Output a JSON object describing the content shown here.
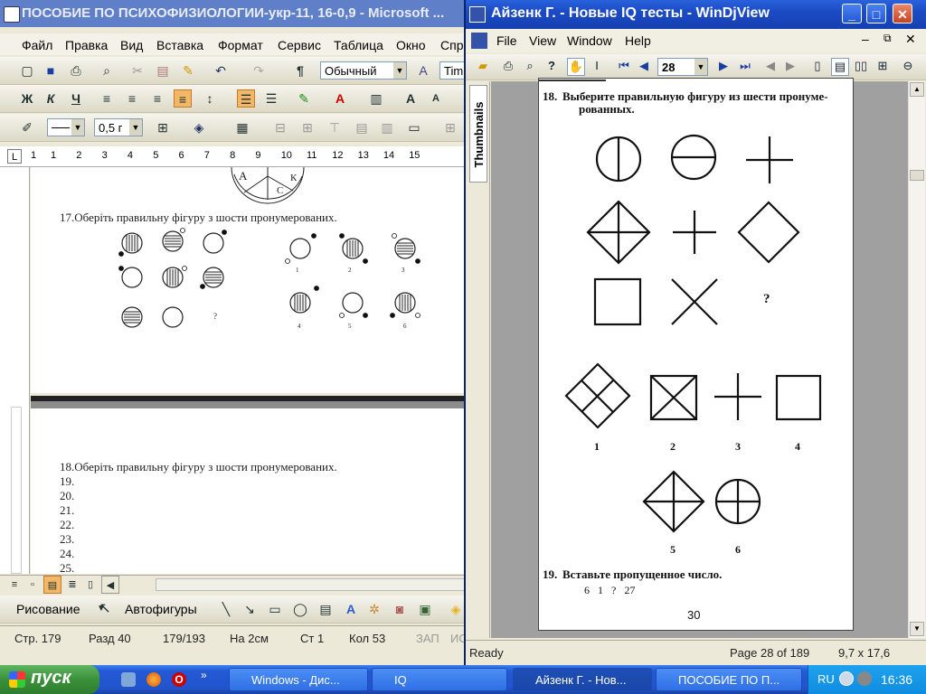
{
  "word": {
    "title": "ПОСОБИЕ ПО ПСИХОФИЗИОЛОГИИ-укр-11, 16-0,9 - Microsoft ...",
    "menu": [
      "Файл",
      "Правка",
      "Вид",
      "Вставка",
      "Формат",
      "Сервис",
      "Таблица",
      "Окно",
      "Спр"
    ],
    "style_combo": "Обычный",
    "font_combo": "Tim",
    "line_width": "0,5 г",
    "ruler_numbers": [
      "1",
      "1",
      "2",
      "3",
      "4",
      "5",
      "6",
      "7",
      "8",
      "9",
      "10",
      "11",
      "12",
      "13",
      "14",
      "15"
    ],
    "page1_labels": [
      "A",
      "C",
      "К"
    ],
    "q17": "17.Оберіть правильну фігуру з шости пронумерованих.",
    "q17_question_mark": "?",
    "q17_option_numbers": [
      "1",
      "2",
      "3",
      "4",
      "5",
      "6"
    ],
    "page2_lines": [
      "18.Оберіть правильну фігуру з шости пронумерованих.",
      "19.",
      "20.",
      "21.",
      "22.",
      "23.",
      "24.",
      "25."
    ],
    "drawing_label": "Рисование",
    "autoshapes_label": "Автофигуры",
    "status": {
      "page": "Стр. 179",
      "section": "Разд 40",
      "pages": "179/193",
      "at": "На 2см",
      "line": "Ст 1",
      "col": "Кол 53",
      "rec": "ЗАП",
      "extra": "ИС"
    }
  },
  "djview": {
    "title": "Айзенк Г. - Новые IQ тесты - WinDjView",
    "menu": [
      "File",
      "View",
      "Window",
      "Help"
    ],
    "page_number": "28",
    "thumbnails_tab": "Thumbnails",
    "q18_number": "18.",
    "q18_line1": "Выберите правильную фигуру из шести пронуме-",
    "q18_line2": "рованных.",
    "question_mark": "?",
    "option_numbers": [
      "1",
      "2",
      "3",
      "4",
      "5",
      "6"
    ],
    "q19_number": "19.",
    "q19_text": "Вставьте пропущенное число.",
    "q19_sequence": "6   1   ?   27",
    "page_footer": "30",
    "status_ready": "Ready",
    "status_page": "Page 28 of 189",
    "status_size": "9,7 x 17,6"
  },
  "taskbar": {
    "start": "пуск",
    "tasks": [
      "Windows - Дис...",
      "IQ",
      "Айзенк Г. - Нов...",
      "ПОСОБИЕ ПО П..."
    ],
    "lang": "RU",
    "clock": "16:36"
  },
  "colors": {
    "xp_blue": "#2459d6",
    "start_green": "#3a913a",
    "word_title": "#5f7fc9"
  }
}
